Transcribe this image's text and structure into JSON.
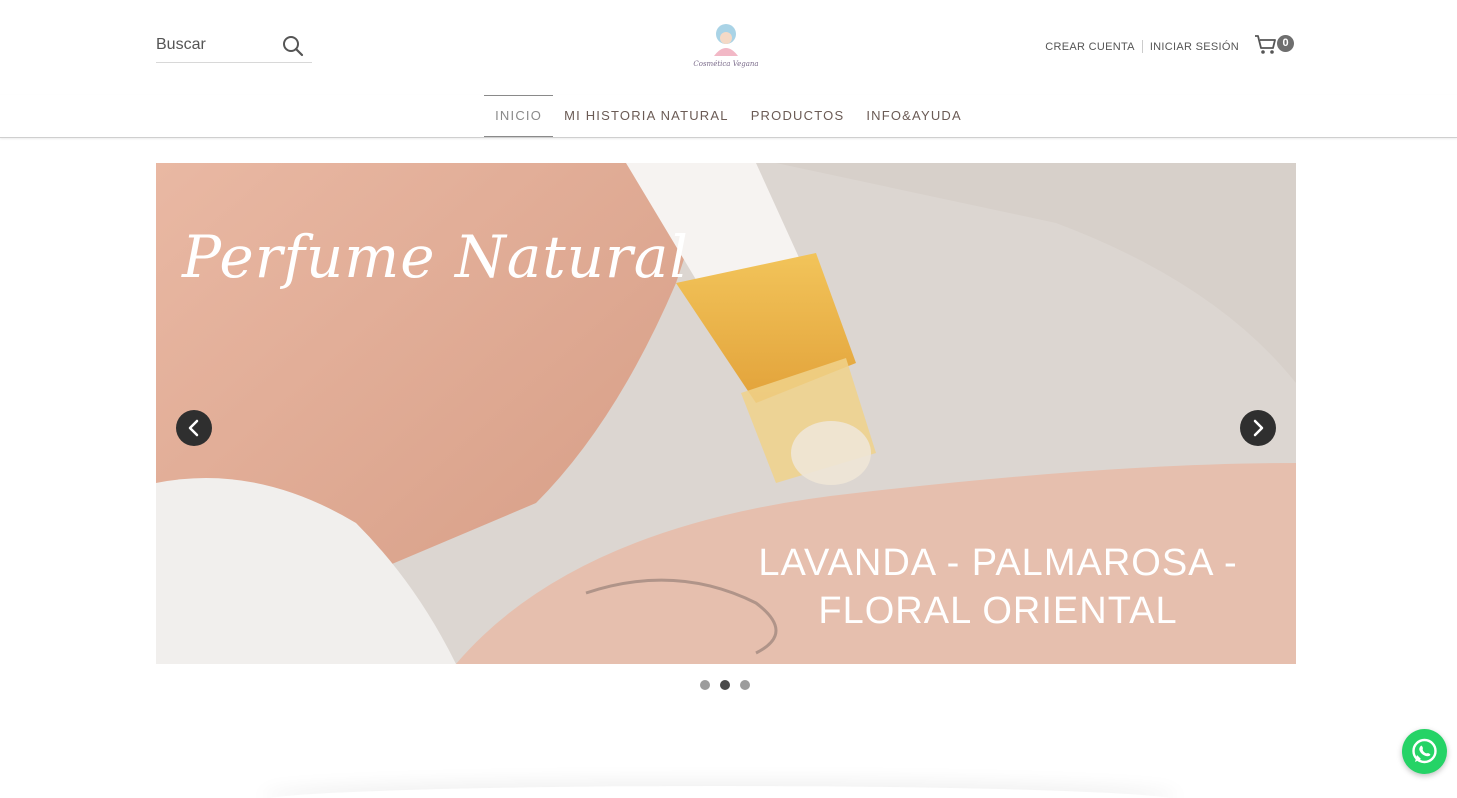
{
  "search": {
    "placeholder": "Buscar",
    "icon": "search-icon"
  },
  "logo": {
    "text": "Cosmética Vegana"
  },
  "account": {
    "create": "CREAR CUENTA",
    "login": "INICIAR SESIÓN"
  },
  "cart": {
    "count": "0",
    "icon": "cart-icon"
  },
  "nav": {
    "items": [
      {
        "label": "INICIO",
        "active": true
      },
      {
        "label": "MI HISTORIA NATURAL",
        "active": false
      },
      {
        "label": "PRODUCTOS",
        "active": false
      },
      {
        "label": "INFO&AYUDA",
        "active": false
      }
    ]
  },
  "slider": {
    "title": "Perfume Natural",
    "subtitle_line1": "LAVANDA - PALMAROSA -",
    "subtitle_line2": "FLORAL ORIENTAL",
    "current_slide": 2,
    "slide_count": 3
  },
  "colors": {
    "accent": "#6b5b55",
    "whatsapp": "#25d366"
  }
}
